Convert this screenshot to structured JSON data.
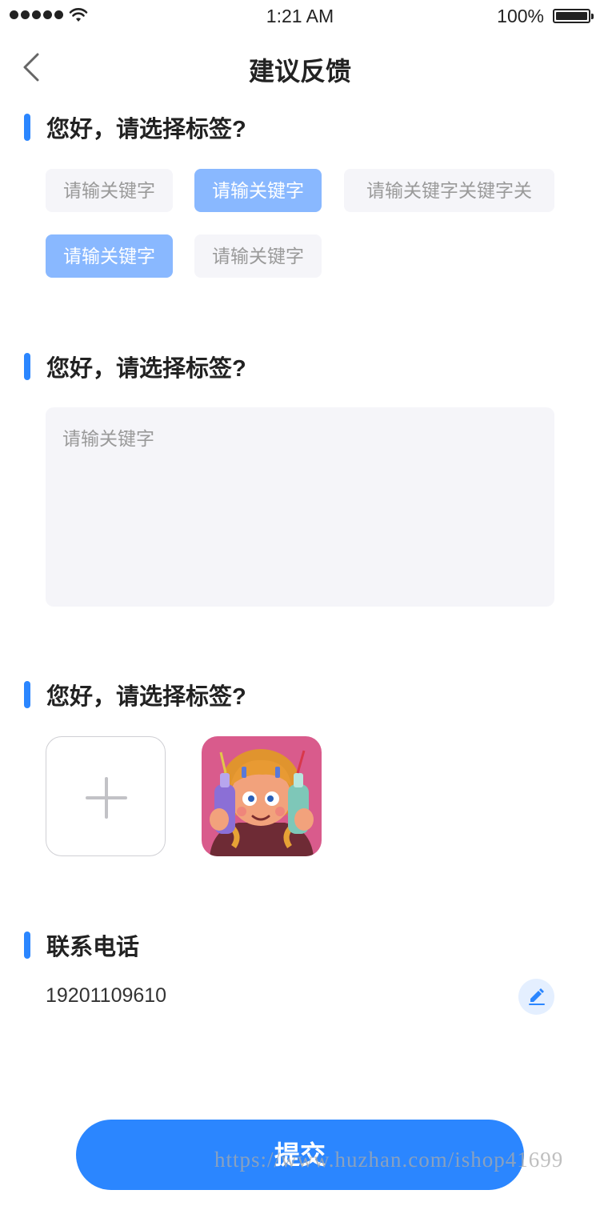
{
  "status_bar": {
    "time": "1:21 AM",
    "battery_percent": "100%",
    "battery_level": 1.0
  },
  "nav": {
    "title": "建议反馈",
    "back_icon": "chevron-left-icon"
  },
  "sections": {
    "tags_title": "您好，请选择标签?",
    "description_title": "您好，请选择标签?",
    "images_title": "您好，请选择标签?",
    "phone_title": "联系电话"
  },
  "tags": [
    {
      "label": "请输关键字",
      "selected": false
    },
    {
      "label": "请输关键字",
      "selected": true
    },
    {
      "label": "请输关键字关键字关",
      "selected": false
    },
    {
      "label": "请输关键字",
      "selected": true
    },
    {
      "label": "请输关键字",
      "selected": false
    }
  ],
  "description": {
    "placeholder": "请输关键字"
  },
  "images": {
    "add_icon": "plus-icon",
    "thumbnail": "uploaded-photo-girl-with-bottles"
  },
  "phone": {
    "value": "19201109610",
    "edit_icon": "pencil-icon"
  },
  "submit": {
    "label": "提交"
  },
  "watermark": "https://www.huzhan.com/ishop41699",
  "colors": {
    "accent": "#2b86ff",
    "tag_selected": "#89b8ff",
    "tag_default": "#f5f5f9",
    "edit_bg": "#e4efff"
  }
}
